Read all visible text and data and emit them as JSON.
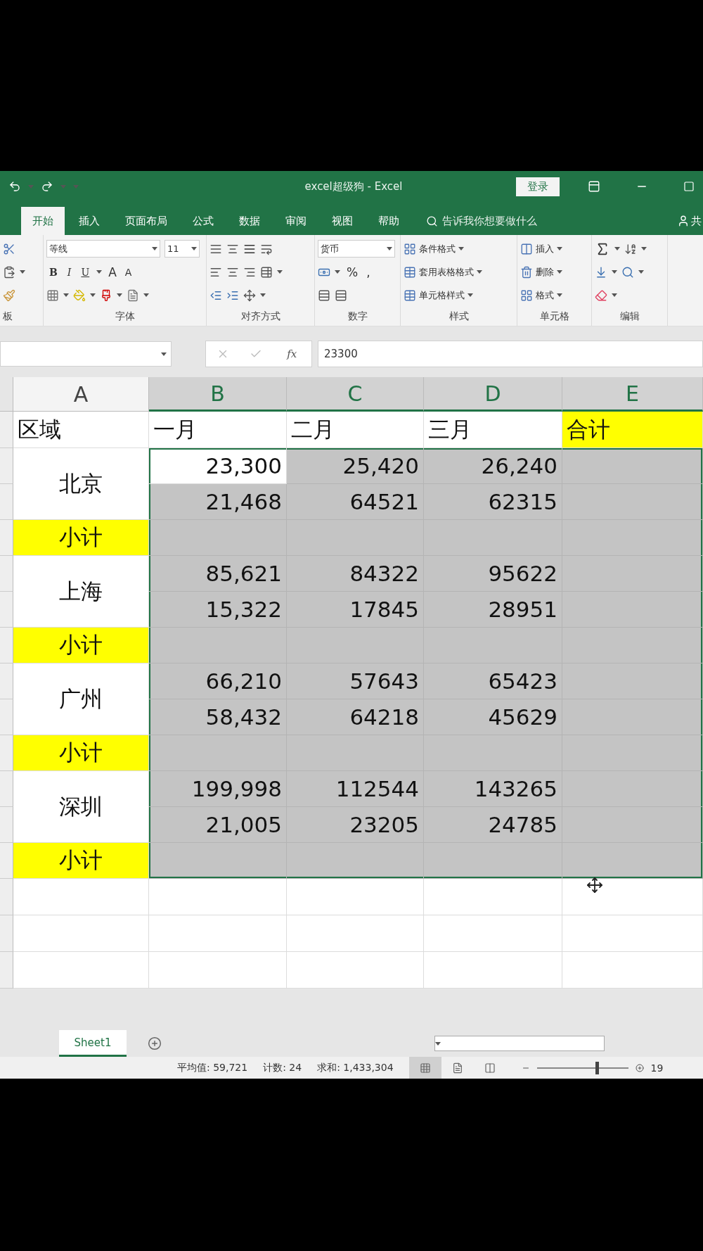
{
  "title_bar": {
    "title": "excel超级狗 - Excel",
    "login": "登录"
  },
  "ribbon_tabs": [
    {
      "label": "开始",
      "selected": true
    },
    {
      "label": "插入",
      "selected": false
    },
    {
      "label": "页面布局",
      "selected": false
    },
    {
      "label": "公式",
      "selected": false
    },
    {
      "label": "数据",
      "selected": false
    },
    {
      "label": "审阅",
      "selected": false
    },
    {
      "label": "视图",
      "selected": false
    },
    {
      "label": "帮助",
      "selected": false
    }
  ],
  "tell_me": "告诉我你想要做什么",
  "share": "共",
  "ribbon": {
    "clipboard_label": "板",
    "font_name": "等线",
    "font_size": "11",
    "font_buttons": [
      "B",
      "I",
      "U"
    ],
    "grow": "A",
    "shrink": "A",
    "font_label": "字体",
    "align_label": "对齐方式",
    "number_format": "货币",
    "percent": "%",
    "comma": ",",
    "number_label": "数字",
    "styles": [
      "条件格式",
      "套用表格格式",
      "单元格样式"
    ],
    "styles_label": "样式",
    "cells": [
      "插入",
      "删除",
      "格式"
    ],
    "cells_label": "单元格",
    "editing_label": "编辑"
  },
  "formula_bar": {
    "fx": "fx",
    "value": "23300"
  },
  "columns": [
    {
      "label": "A",
      "selected": false
    },
    {
      "label": "B",
      "selected": true
    },
    {
      "label": "C",
      "selected": true
    },
    {
      "label": "D",
      "selected": true
    },
    {
      "label": "E",
      "selected": true
    }
  ],
  "header_row": [
    {
      "text": "区域",
      "highlighted": false
    },
    {
      "text": "一月",
      "highlighted": false
    },
    {
      "text": "二月",
      "highlighted": false
    },
    {
      "text": "三月",
      "highlighted": false
    },
    {
      "text": "合计",
      "highlighted": true
    }
  ],
  "groups": [
    {
      "region": "北京",
      "rows": [
        [
          {
            "text": "23,300",
            "selected": false
          },
          {
            "text": "25,420",
            "selected": true
          },
          {
            "text": "26,240",
            "selected": true
          },
          {
            "selected": true
          }
        ],
        [
          {
            "text": "21,468",
            "selected": true
          },
          {
            "text": "64521",
            "selected": true
          },
          {
            "text": "62315",
            "selected": true
          },
          {
            "selected": true
          }
        ]
      ],
      "subtotal": {
        "label": "小计",
        "highlighted": true,
        "cells": [
          {
            "selected": true
          },
          {
            "selected": true
          },
          {
            "selected": true
          },
          {
            "selected": true
          }
        ]
      }
    },
    {
      "region": "上海",
      "rows": [
        [
          {
            "text": "85,621",
            "selected": true
          },
          {
            "text": "84322",
            "selected": true
          },
          {
            "text": "95622",
            "selected": true
          },
          {
            "selected": true
          }
        ],
        [
          {
            "text": "15,322",
            "selected": true
          },
          {
            "text": "17845",
            "selected": true
          },
          {
            "text": "28951",
            "selected": true
          },
          {
            "selected": true
          }
        ]
      ],
      "subtotal": {
        "label": "小计",
        "highlighted": true,
        "cells": [
          {
            "selected": true
          },
          {
            "selected": true
          },
          {
            "selected": true
          },
          {
            "selected": true
          }
        ]
      }
    },
    {
      "region": "广州",
      "rows": [
        [
          {
            "text": "66,210",
            "selected": true
          },
          {
            "text": "57643",
            "selected": true
          },
          {
            "text": "65423",
            "selected": true
          },
          {
            "selected": true
          }
        ],
        [
          {
            "text": "58,432",
            "selected": true
          },
          {
            "text": "64218",
            "selected": true
          },
          {
            "text": "45629",
            "selected": true
          },
          {
            "selected": true
          }
        ]
      ],
      "subtotal": {
        "label": "小计",
        "highlighted": true,
        "cells": [
          {
            "selected": true
          },
          {
            "selected": true
          },
          {
            "selected": true
          },
          {
            "selected": true
          }
        ]
      }
    },
    {
      "region": "深圳",
      "rows": [
        [
          {
            "text": "199,998",
            "selected": true
          },
          {
            "text": "112544",
            "selected": true
          },
          {
            "text": "143265",
            "selected": true
          },
          {
            "selected": true
          }
        ],
        [
          {
            "text": "21,005",
            "selected": true
          },
          {
            "text": "23205",
            "selected": true
          },
          {
            "text": "24785",
            "selected": true
          },
          {
            "selected": true
          }
        ]
      ],
      "subtotal": {
        "label": "小计",
        "highlighted": true,
        "cells": [
          {
            "selected": true
          },
          {
            "selected": true
          },
          {
            "selected": true
          },
          {
            "selected": true
          }
        ]
      }
    }
  ],
  "sheet_tabs": [
    {
      "label": "Sheet1",
      "selected": true
    }
  ],
  "status": {
    "average": "平均值: 59,721",
    "count": "计数: 24",
    "sum": "求和: 1,433,304",
    "zoom_slider": {
      "level": 0.64
    },
    "zoom": "19"
  }
}
